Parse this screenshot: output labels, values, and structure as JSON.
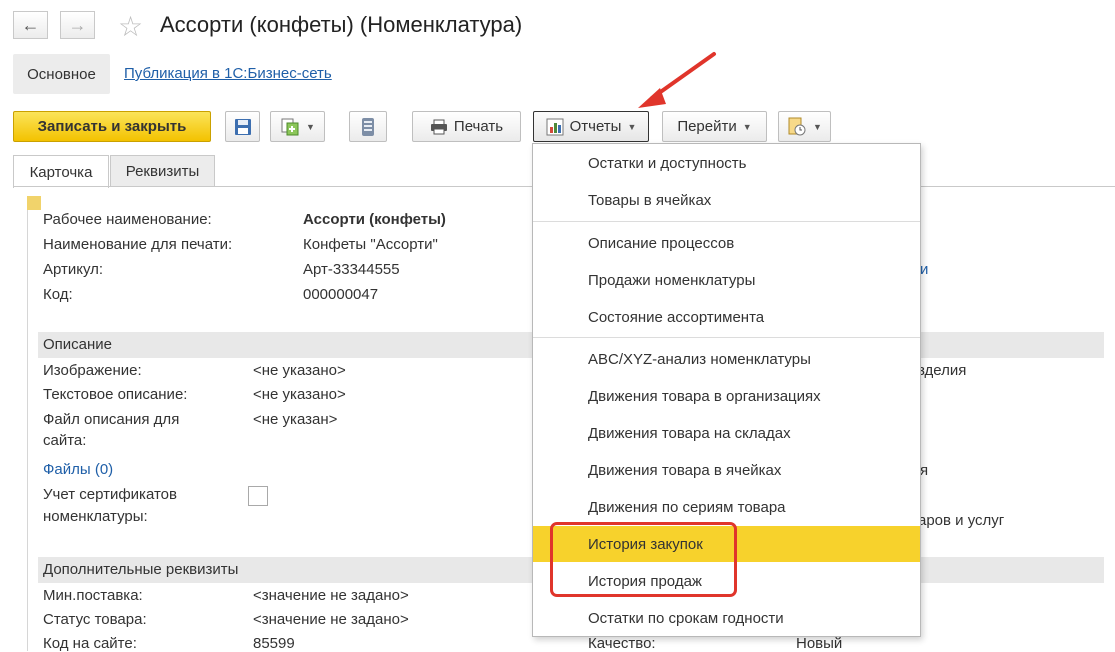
{
  "window": {
    "title": "Ассорти (конфеты) (Номенклатура)"
  },
  "sections": {
    "main": "Основное",
    "publish_link": "Публикация в 1С:Бизнес-сеть"
  },
  "toolbar": {
    "save_close": "Записать и закрыть",
    "print": "Печать",
    "reports": "Отчеты",
    "goto": "Перейти"
  },
  "tabs": [
    "Карточка",
    "Реквизиты"
  ],
  "card": {
    "work_name_label": "Рабочее наименование:",
    "work_name": "Ассорти (конфеты)",
    "print_name_label": "Наименование для печати:",
    "print_name": "Конфеты \"Ассорти\"",
    "article_label": "Артикул:",
    "article": "Арт-33344555",
    "code_label": "Код:",
    "code": "000000047"
  },
  "description": {
    "header": "Описание",
    "image_label": "Изображение:",
    "image_value": "<не указано>",
    "text_label": "Текстовое описание:",
    "text_value": "<не указано>",
    "file_label_1": "Файл описания для",
    "file_label_2": "сайта:",
    "file_value": "<не указан>",
    "files_link": "Файлы (0)",
    "cert_label_1": "Учет сертификатов",
    "cert_label_2": "номенклатуры:"
  },
  "additional": {
    "header": "Дополнительные реквизиты",
    "min_supply_label": "Мин.поставка:",
    "min_supply_value": "<значение не задано>",
    "status_label": "Статус товара:",
    "status_value": "<значение не задано>",
    "site_code_label": "Код на сайте:",
    "site_code_value": "85599",
    "quality_label": "Качество:",
    "quality_value": "Новый"
  },
  "right_fragments": {
    "frag1": "и",
    "frag2": "зделия",
    "frag3": "я",
    "frag4": "аров и услуг"
  },
  "reports_menu": {
    "group1": [
      "Остатки и доступность",
      "Товары в ячейках"
    ],
    "group2": [
      "Описание процессов",
      "Продажи номенклатуры",
      "Состояние ассортимента"
    ],
    "group3": [
      "ABC/XYZ-анализ номенклатуры",
      "Движения товара в организациях",
      "Движения товара на складах",
      "Движения товара в ячейках",
      "Движения по сериям товара",
      "История закупок",
      "История продаж",
      "Остатки по срокам годности"
    ],
    "highlighted": "История закупок"
  },
  "colors": {
    "accent_yellow": "#f7d22c",
    "link_blue": "#1f5fa8",
    "annotation_red": "#e0352b"
  }
}
